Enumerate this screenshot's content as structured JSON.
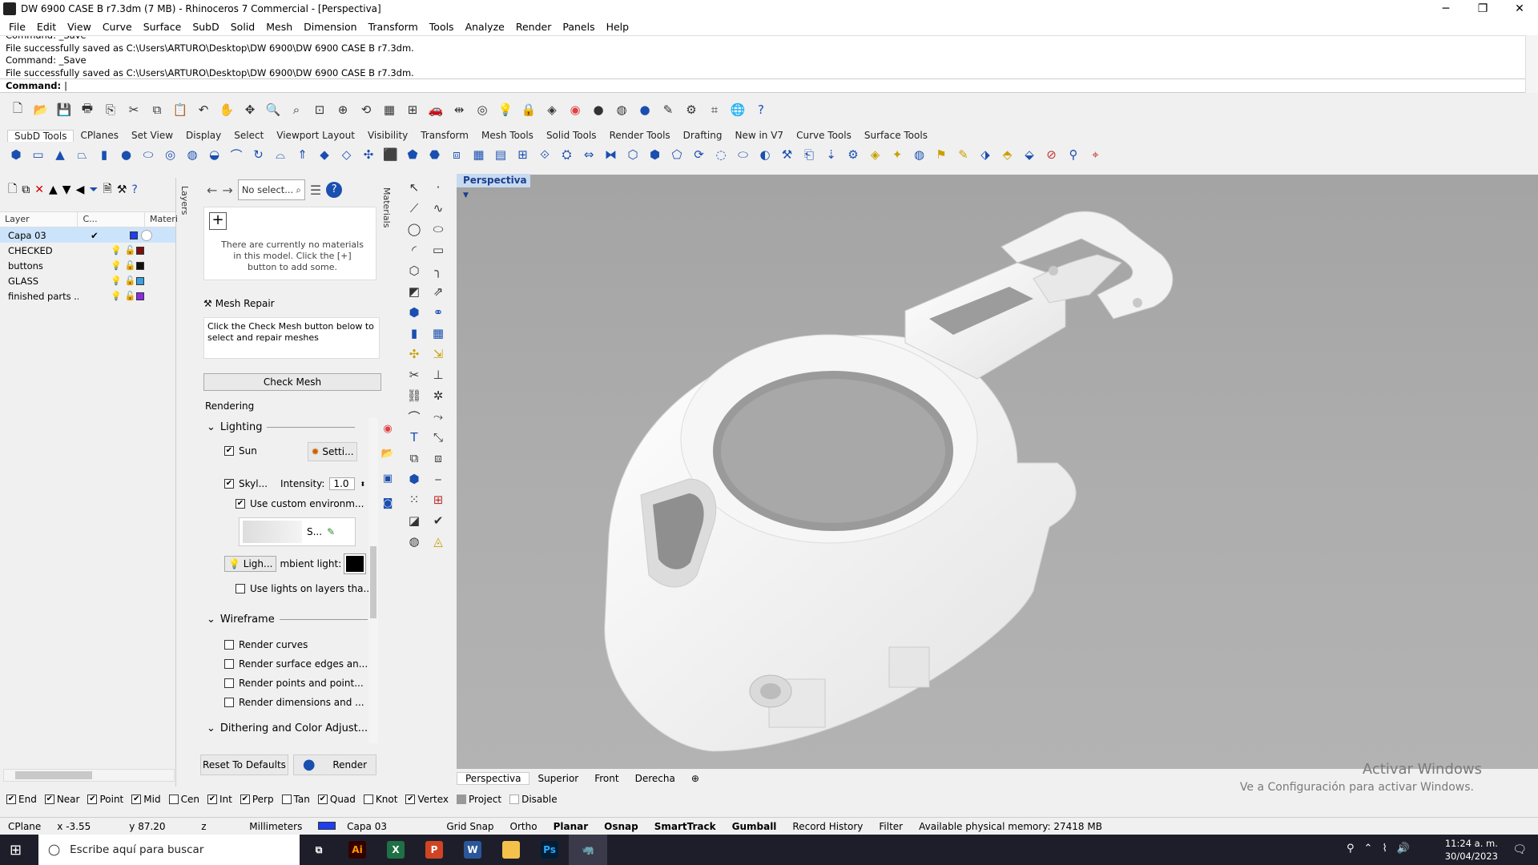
{
  "window": {
    "title": "DW 6900 CASE B r7.3dm (7 MB) - Rhinoceros 7 Commercial - [Perspectiva]",
    "min": "─",
    "max": "❐",
    "close": "✕"
  },
  "menu": [
    "File",
    "Edit",
    "View",
    "Curve",
    "Surface",
    "SubD",
    "Solid",
    "Mesh",
    "Dimension",
    "Transform",
    "Tools",
    "Analyze",
    "Render",
    "Panels",
    "Help"
  ],
  "command_history": [
    "Command: _Save",
    "File successfully saved as C:\\Users\\ARTURO\\Desktop\\DW 6900\\DW 6900 CASE B r7.3dm.",
    "Command: _Save",
    "File successfully saved as C:\\Users\\ARTURO\\Desktop\\DW 6900\\DW 6900 CASE B r7.3dm."
  ],
  "command_prompt": "Command:",
  "tabs": [
    "SubD Tools",
    "CPlanes",
    "Set View",
    "Display",
    "Select",
    "Viewport Layout",
    "Visibility",
    "Transform",
    "Mesh Tools",
    "Solid Tools",
    "Render Tools",
    "Drafting",
    "New in V7",
    "Curve Tools",
    "Surface Tools"
  ],
  "layers": {
    "columns": [
      "Layer",
      "C...",
      "Materi"
    ],
    "vtab": "Layers",
    "rows": [
      {
        "name": "Capa 03",
        "color": "#1c3ff0",
        "current": true
      },
      {
        "name": "CHECKED",
        "color": "#7a1010"
      },
      {
        "name": "buttons",
        "color": "#111111"
      },
      {
        "name": "GLASS",
        "color": "#3aa0e0"
      },
      {
        "name": "finished parts ...",
        "color": "#8a2be2"
      }
    ]
  },
  "materials": {
    "search_placeholder": "No select...",
    "vtab": "Materials",
    "empty_text": "There are currently no materials in this model. Click the [+] button to add some."
  },
  "mesh_repair": {
    "title": "Mesh Repair",
    "text": "Click the Check Mesh button below to select and repair meshes",
    "button": "Check Mesh"
  },
  "rendering": {
    "title": "Rendering",
    "lighting": "Lighting",
    "sun": "Sun",
    "sun_settings": "Setti...",
    "skylight": "Skyl...",
    "intensity_label": "Intensity:",
    "intensity": "1.0",
    "custom_env": "Use custom environm...",
    "env_label": "S...",
    "lights_btn": "Ligh...",
    "ambient": "mbient light:",
    "lights_on_layers": "Use lights on layers tha...",
    "wireframe": "Wireframe",
    "render_curves": "Render curves",
    "render_edges": "Render surface edges an...",
    "render_points": "Render points and point...",
    "render_dims": "Render dimensions and ...",
    "dithering": "Dithering and Color Adjust...",
    "reset": "Reset To Defaults",
    "render": "Render"
  },
  "viewport": {
    "label": "Perspectiva",
    "tabs": [
      "Perspectiva",
      "Superior",
      "Front",
      "Derecha"
    ],
    "watermark": "Activar Windows",
    "watermark2": "Ve a Configuración para activar Windows."
  },
  "osnaps": [
    {
      "label": "End",
      "checked": true
    },
    {
      "label": "Near",
      "checked": true
    },
    {
      "label": "Point",
      "checked": true
    },
    {
      "label": "Mid",
      "checked": true
    },
    {
      "label": "Cen",
      "checked": false
    },
    {
      "label": "Int",
      "checked": true
    },
    {
      "label": "Perp",
      "checked": true
    },
    {
      "label": "Tan",
      "checked": false
    },
    {
      "label": "Quad",
      "checked": true
    },
    {
      "label": "Knot",
      "checked": false
    },
    {
      "label": "Vertex",
      "checked": true
    },
    {
      "label": "Project",
      "checked": false
    },
    {
      "label": "Disable",
      "checked": false
    }
  ],
  "status": {
    "cplane": "CPlane",
    "x": "x -3.55",
    "y": "y 87.20",
    "z": "z",
    "units": "Millimeters",
    "layer": "Capa 03",
    "items": [
      "Grid Snap",
      "Ortho",
      "Planar",
      "Osnap",
      "SmartTrack",
      "Gumball",
      "Record History",
      "Filter"
    ],
    "memory": "Available physical memory: 27418 MB"
  },
  "taskbar": {
    "search": "Escribe aquí para buscar",
    "time": "11:24 a. m.",
    "date": "30/04/2023"
  }
}
